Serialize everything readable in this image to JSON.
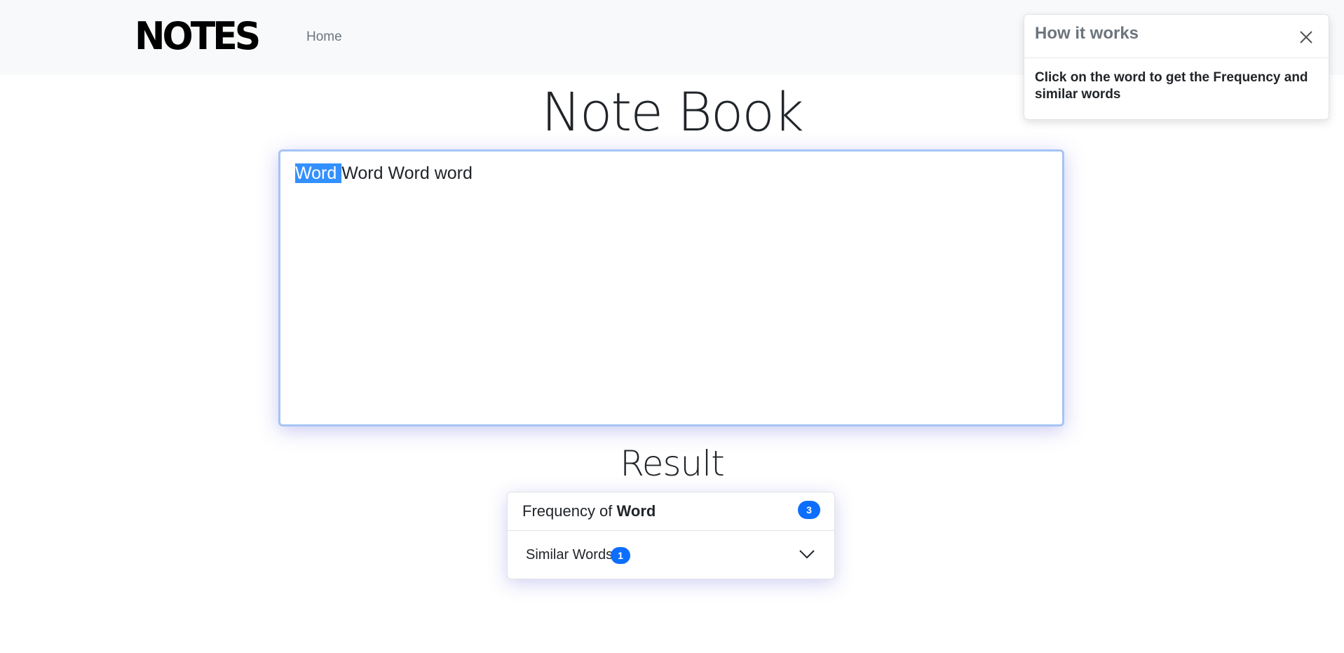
{
  "navbar": {
    "brand": "NOTES",
    "links": [
      {
        "label": "Home"
      }
    ]
  },
  "toast": {
    "title": "How it works",
    "body": "Click on the word to get the Frequency and similar words",
    "close_icon": "close-icon"
  },
  "page": {
    "title": "Note Book"
  },
  "note": {
    "words": [
      "Word",
      "Word",
      "Word",
      "word"
    ],
    "selected_word": "Word",
    "selection_color": "#3390ff"
  },
  "result": {
    "title": "Result",
    "frequency_prefix": "Frequency of ",
    "frequency_word": "Word",
    "frequency_count": "3",
    "similar_label": "Similar Words",
    "similar_count": "1",
    "expand_icon": "chevron-down-icon",
    "badge_color": "#0d6efd"
  }
}
